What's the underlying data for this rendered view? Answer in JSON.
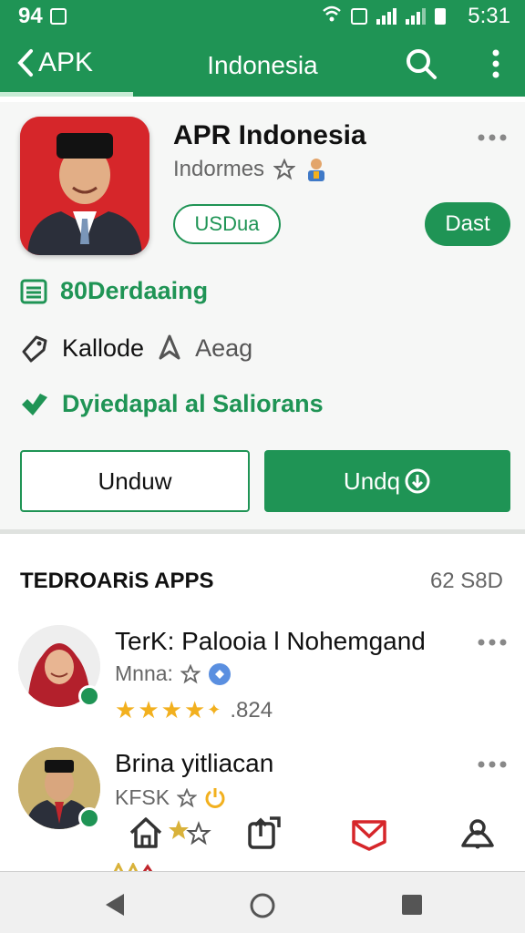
{
  "status_bar": {
    "left_text": "94",
    "time": "5:31"
  },
  "app_bar": {
    "back_label": "APK",
    "title": "Indonesia"
  },
  "app": {
    "title": "APR Indonesia",
    "developer": "Indormes",
    "price_pill": "USDua",
    "action_badge": "Dast",
    "stat_1": "80Derdaaing",
    "stat_2a": "Kallode",
    "stat_2b": "Aeag",
    "stat_3": "Dyiedapal al Saliorans",
    "secondary_button": "Unduw",
    "primary_button": "Undq"
  },
  "section": {
    "title": "TEDROARiS APPS",
    "count": "62 S8D"
  },
  "list_items": [
    {
      "title": "TerK: Palooia l Nohemgand",
      "sub": "Mnna:",
      "rating": ".824",
      "stars_filled": 4.5
    },
    {
      "title": "Brina yitliacan",
      "sub": "KFSK"
    }
  ],
  "colors": {
    "primary": "#1f9455",
    "star": "#f2b01e",
    "nav_red": "#d6262a"
  },
  "icons": [
    "back-chevron-icon",
    "search-icon",
    "more-vert-icon",
    "star-outline-icon",
    "list-icon",
    "tag-icon",
    "navigation-icon",
    "check-shield-icon",
    "home-icon",
    "share-icon",
    "mail-icon",
    "account-icon"
  ]
}
